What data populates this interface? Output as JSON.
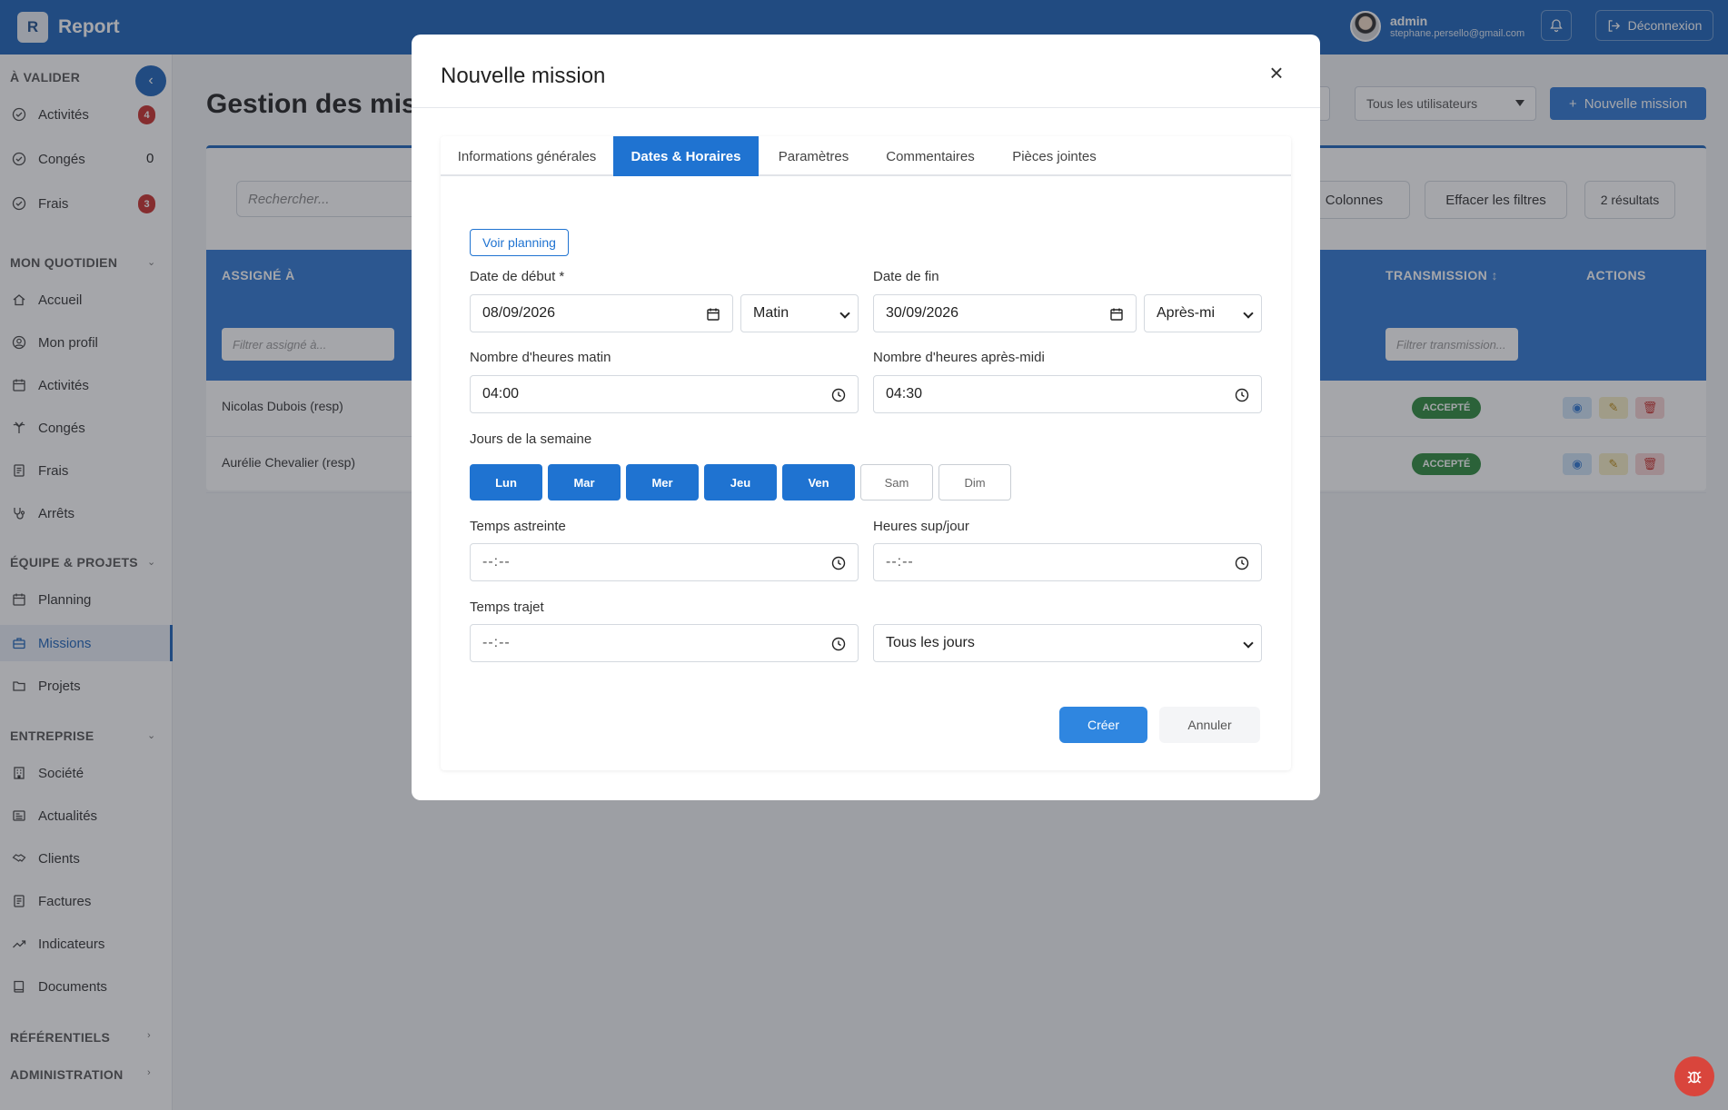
{
  "app": {
    "logo_letter": "R",
    "name": "Report"
  },
  "user": {
    "name": "admin",
    "email": "stephane.persello@gmail.com",
    "logout_label": "Déconnexion"
  },
  "sidebar": {
    "sections": {
      "a_valider": "À VALIDER",
      "mon_quotidien": "MON QUOTIDIEN",
      "equipe_projets": "ÉQUIPE & PROJETS",
      "entreprise": "ENTREPRISE",
      "referentiels": "RÉFÉRENTIELS",
      "administration": "ADMINISTRATION"
    },
    "validation": [
      {
        "label": "Activités",
        "count": "4"
      },
      {
        "label": "Congés",
        "count": "0"
      },
      {
        "label": "Frais",
        "count": "3"
      }
    ],
    "quotidien": [
      "Accueil",
      "Mon profil",
      "Activités",
      "Congés",
      "Frais",
      "Arrêts"
    ],
    "equipe": [
      "Planning",
      "Missions",
      "Projets"
    ],
    "entreprise_items": [
      "Société",
      "Actualités",
      "Clients",
      "Factures",
      "Indicateurs",
      "Documents"
    ]
  },
  "main": {
    "title": "Gestion des missions",
    "new_button": "Nouvelle mission",
    "users_select": "Tous les utilisateurs",
    "search_placeholder": "Rechercher...",
    "columns_button": "Colonnes",
    "clear_filters": "Effacer les filtres",
    "results": "2 résultats",
    "columns": {
      "assigned": "ASSIGNÉ À",
      "transmission": "TRANSMISSION",
      "actions": "ACTIONS"
    },
    "filters": {
      "assigned": "Filtrer assigné à...",
      "transmission": "Filtrer transmission..."
    },
    "rows": [
      {
        "name": "Nicolas Dubois (resp)",
        "status": "ACCEPTÉ"
      },
      {
        "name": "Aurélie Chevalier (resp)",
        "status": "ACCEPTÉ"
      }
    ]
  },
  "modal": {
    "title": "Nouvelle mission",
    "tabs": [
      "Informations générales",
      "Dates & Horaires",
      "Paramètres",
      "Commentaires",
      "Pièces jointes"
    ],
    "active_tab": "Dates & Horaires",
    "voir_planning": "Voir planning",
    "date_debut": {
      "label": "Date de début *",
      "value": "08/09/2026",
      "period": "Matin"
    },
    "date_fin": {
      "label": "Date de fin",
      "value": "30/09/2026",
      "period": "Après-mi"
    },
    "heures_matin": {
      "label": "Nombre d'heures matin",
      "value": "04:00"
    },
    "heures_apres_midi": {
      "label": "Nombre d'heures après-midi",
      "value": "04:30"
    },
    "jours_label": "Jours de la semaine",
    "jours": [
      {
        "label": "Lun",
        "selected": true
      },
      {
        "label": "Mar",
        "selected": true
      },
      {
        "label": "Mer",
        "selected": true
      },
      {
        "label": "Jeu",
        "selected": true
      },
      {
        "label": "Ven",
        "selected": true
      },
      {
        "label": "Sam",
        "selected": false
      },
      {
        "label": "Dim",
        "selected": false
      }
    ],
    "temps_astreinte": {
      "label": "Temps astreinte",
      "value": "--:--"
    },
    "heures_sup": {
      "label": "Heures sup/jour",
      "value": "--:--"
    },
    "temps_trajet": {
      "label": "Temps trajet",
      "value": "--:--"
    },
    "frequence": "Tous les jours",
    "create_button": "Créer",
    "cancel_button": "Annuler"
  },
  "colors": {
    "primary": "#1f73d1",
    "topbar": "#1d63b8",
    "danger": "#c9302c",
    "success": "#2e8b3d"
  }
}
